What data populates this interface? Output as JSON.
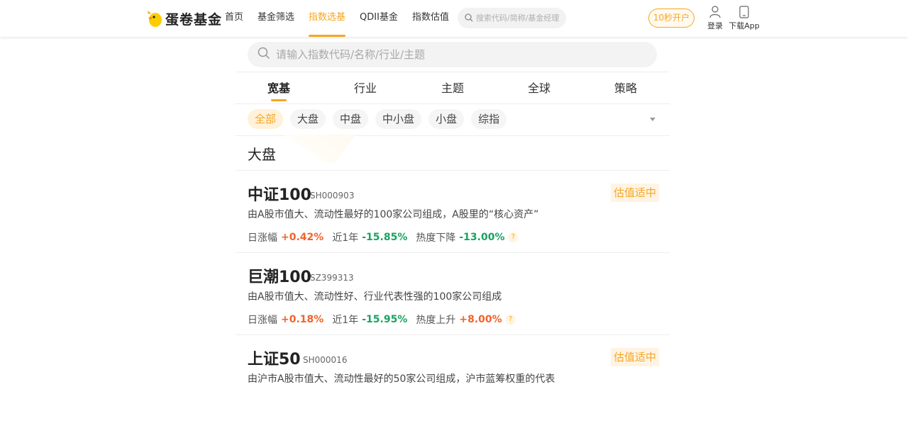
{
  "header": {
    "logo_text": "蛋卷基金",
    "nav": [
      {
        "label": "首页",
        "active": false
      },
      {
        "label": "基金筛选",
        "active": false
      },
      {
        "label": "指数选基",
        "active": true
      },
      {
        "label": "QDII基金",
        "active": false
      },
      {
        "label": "指数估值",
        "active": false
      }
    ],
    "search_placeholder": "搜索代码/简称/基金经理",
    "open_account": "10秒开户",
    "login": "登录",
    "download": "下载App"
  },
  "main": {
    "search_placeholder": "请输入指数代码/名称/行业/主题",
    "tabs": [
      {
        "label": "宽基",
        "active": true
      },
      {
        "label": "行业",
        "active": false
      },
      {
        "label": "主题",
        "active": false
      },
      {
        "label": "全球",
        "active": false
      },
      {
        "label": "策略",
        "active": false
      }
    ],
    "chips": [
      {
        "label": "全部",
        "active": true
      },
      {
        "label": "大盘",
        "active": false
      },
      {
        "label": "中盘",
        "active": false
      },
      {
        "label": "中小盘",
        "active": false
      },
      {
        "label": "小盘",
        "active": false
      },
      {
        "label": "综指",
        "active": false
      }
    ],
    "section_title": "大盘",
    "funds": [
      {
        "name": "中证100",
        "code": "SH000903",
        "badge": "估值适中",
        "desc": "由A股市值大、流动性最好的100家公司组成，A股里的“核心资产”",
        "daily_label": "日涨幅",
        "daily": "+0.42%",
        "year_label": "近1年",
        "year": "-15.85%",
        "heat_label": "热度下降",
        "heat": "-13.00%"
      },
      {
        "name": "巨潮100",
        "code": "SZ399313",
        "badge": "",
        "desc": "由A股市值大、流动性好、行业代表性强的100家公司组成",
        "daily_label": "日涨幅",
        "daily": "+0.18%",
        "year_label": "近1年",
        "year": "-15.95%",
        "heat_label": "热度上升",
        "heat": "+8.00%"
      },
      {
        "name": "上证50",
        "code": "SH000016",
        "badge": "估值适中",
        "desc": "由沪市A股市值大、流动性最好的50家公司组成，沪市蓝筹权重的代表"
      }
    ],
    "help_mark": "?"
  },
  "colors": {
    "accent": "#f5a623",
    "up": "#f0622a",
    "down": "#1aa260"
  }
}
